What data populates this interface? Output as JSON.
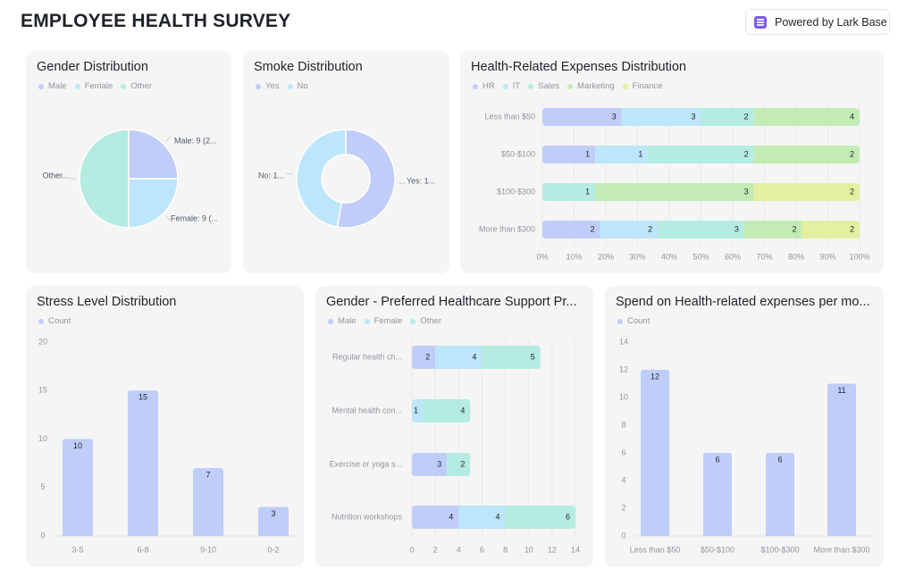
{
  "header": {
    "title": "EMPLOYEE HEALTH SURVEY",
    "badge": "Powered by Lark Base",
    "badge_icon": "lark-base-logo-icon"
  },
  "colors": {
    "c1": "#c0cdf8",
    "c2": "#bde6fa",
    "c3": "#b5ece2",
    "c4": "#c3ecb5",
    "c5": "#e4f0a0"
  },
  "chart_data": [
    {
      "id": "gender",
      "type": "pie",
      "title": "Gender Distribution",
      "legend": [
        "Male",
        "Female",
        "Other"
      ],
      "values": [
        9,
        9,
        18
      ],
      "labels": [
        "Male: 9 (2...",
        "Female: 9 (...",
        "Other..."
      ]
    },
    {
      "id": "smoke",
      "type": "donut",
      "title": "Smoke Distribution",
      "legend": [
        "Yes",
        "No"
      ],
      "values": [
        19,
        17
      ],
      "labels": [
        "Yes: 1...",
        "No: 1..."
      ]
    },
    {
      "id": "expenses",
      "type": "bar",
      "orientation": "horizontal",
      "stacked": "percent",
      "title": "Health-Related Expenses Distribution",
      "legend": [
        "HR",
        "IT",
        "Sales",
        "Marketing",
        "Finance"
      ],
      "categories": [
        "Less than $50",
        "$50-$100",
        "$100-$300",
        "More than $300"
      ],
      "series": [
        {
          "name": "HR",
          "values": [
            3,
            1,
            0,
            2
          ]
        },
        {
          "name": "IT",
          "values": [
            3,
            1,
            0,
            2
          ]
        },
        {
          "name": "Sales",
          "values": [
            2,
            2,
            1,
            3
          ]
        },
        {
          "name": "Marketing",
          "values": [
            4,
            2,
            3,
            2
          ]
        },
        {
          "name": "Finance",
          "values": [
            0,
            0,
            2,
            2
          ]
        }
      ],
      "xticks": [
        "0%",
        "10%",
        "20%",
        "30%",
        "40%",
        "50%",
        "60%",
        "70%",
        "80%",
        "90%",
        "100%"
      ],
      "grid": true
    },
    {
      "id": "stress",
      "type": "bar",
      "orientation": "vertical",
      "title": "Stress Level Distribution",
      "legend": [
        "Count"
      ],
      "categories": [
        "3-5",
        "6-8",
        "9-10",
        "0-2"
      ],
      "values": [
        10,
        15,
        7,
        3
      ],
      "ylim": [
        0,
        20
      ],
      "yticks": [
        "0",
        "5",
        "10",
        "15",
        "20"
      ]
    },
    {
      "id": "support",
      "type": "bar",
      "orientation": "horizontal",
      "stacked": "absolute",
      "title": "Gender - Preferred Healthcare Support Pr...",
      "legend": [
        "Male",
        "Female",
        "Other"
      ],
      "categories": [
        "Regular health ch...",
        "Mental health con...",
        "Exercise or yoga s...",
        "Nutrition workshops"
      ],
      "series": [
        {
          "name": "Male",
          "values": [
            2,
            0,
            3,
            4
          ]
        },
        {
          "name": "Female",
          "values": [
            4,
            1,
            0,
            4
          ]
        },
        {
          "name": "Other",
          "values": [
            5,
            4,
            2,
            6
          ]
        }
      ],
      "xlim": [
        0,
        14
      ],
      "xticks": [
        "0",
        "2",
        "4",
        "6",
        "8",
        "10",
        "12",
        "14"
      ],
      "grid": true
    },
    {
      "id": "spend",
      "type": "bar",
      "orientation": "vertical",
      "title": "Spend on Health-related expenses per mo...",
      "legend": [
        "Count"
      ],
      "categories": [
        "Less than $50",
        "$50-$100",
        "$100-$300",
        "More than $300"
      ],
      "values": [
        12,
        6,
        6,
        11
      ],
      "ylim": [
        0,
        14
      ],
      "yticks": [
        "0",
        "2",
        "4",
        "6",
        "8",
        "10",
        "12",
        "14"
      ]
    }
  ]
}
